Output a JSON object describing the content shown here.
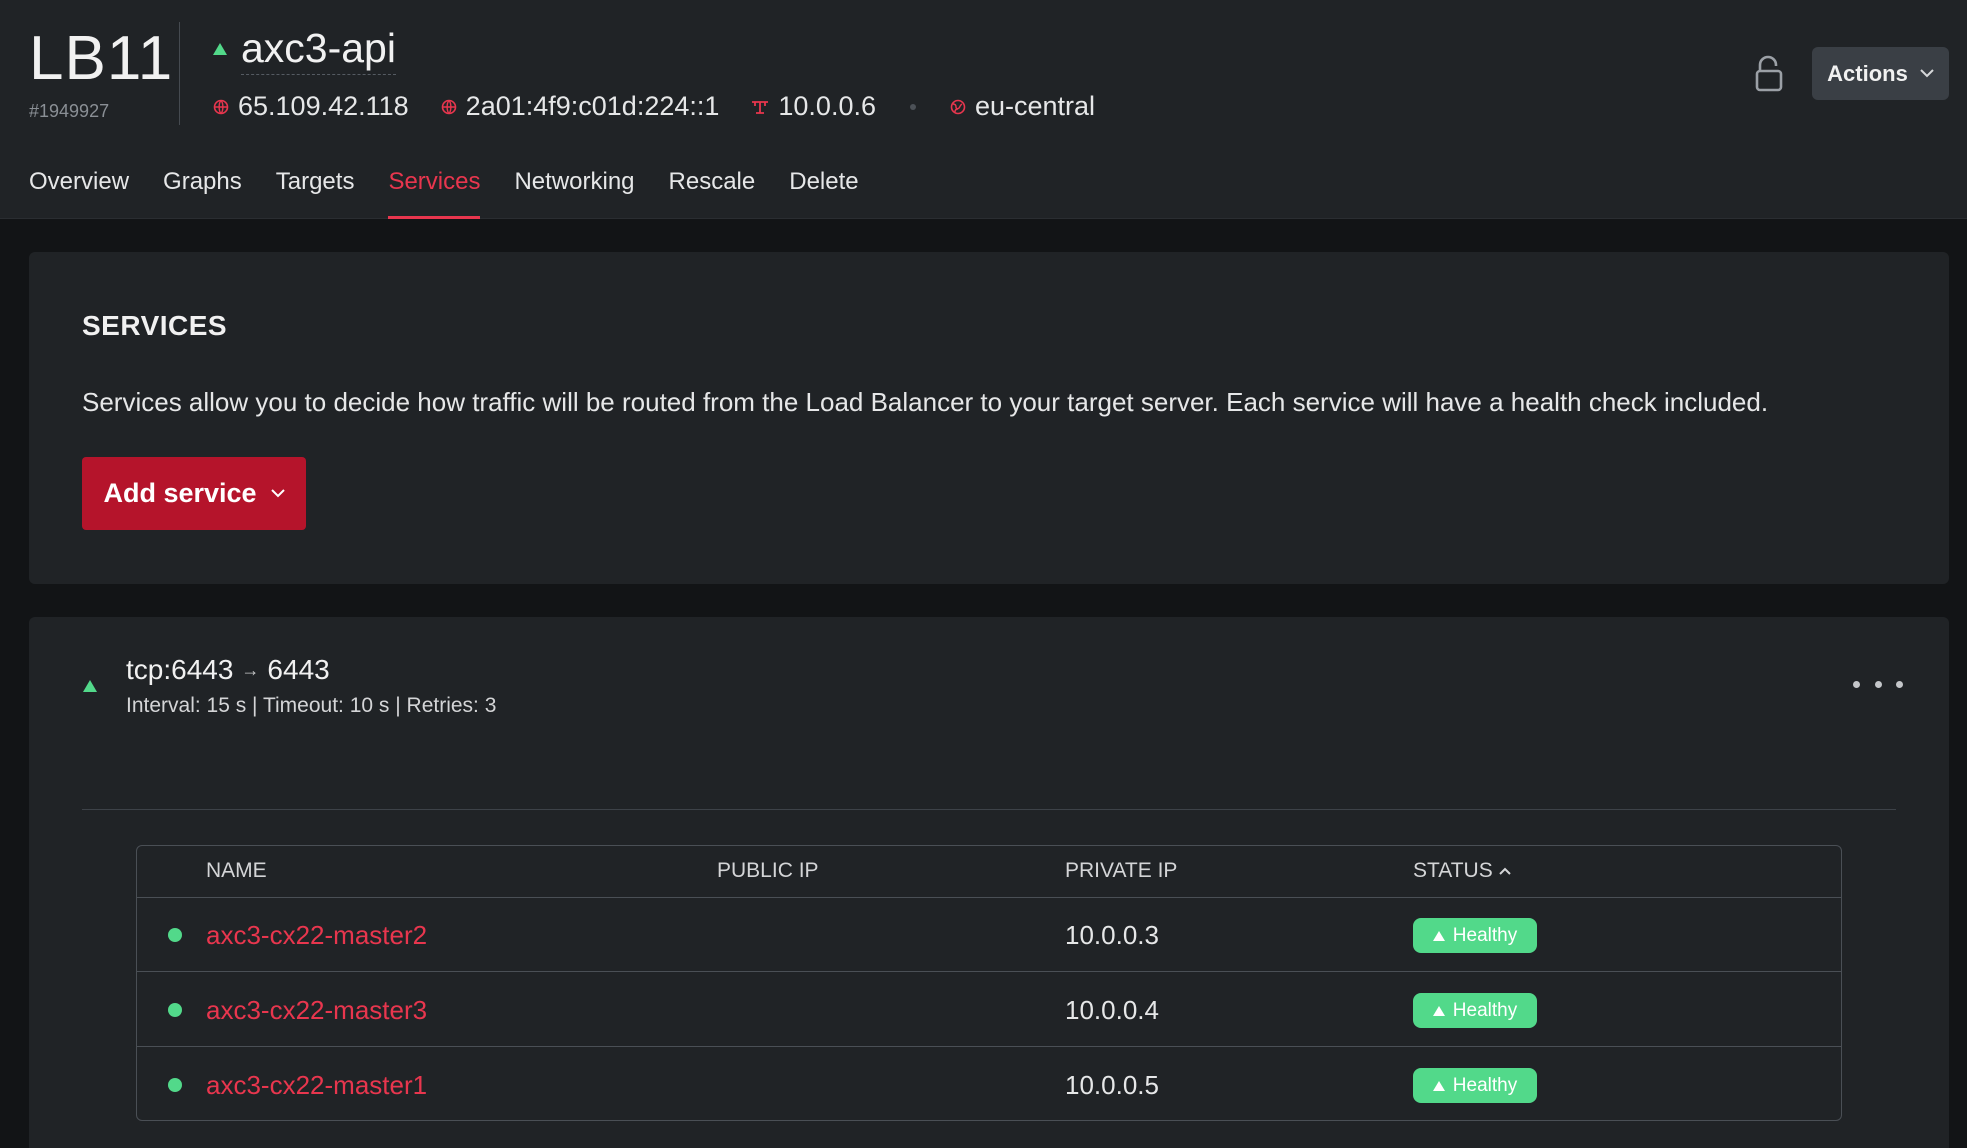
{
  "header": {
    "type": "LB11",
    "id": "#1949927",
    "name": "axc3-api",
    "ipv4": "65.109.42.118",
    "ipv6": "2a01:4f9:c01d:224::1",
    "private_ip": "10.0.0.6",
    "location": "eu-central",
    "actions_label": "Actions"
  },
  "tabs": [
    {
      "label": "Overview"
    },
    {
      "label": "Graphs"
    },
    {
      "label": "Targets"
    },
    {
      "label": "Services",
      "active": true
    },
    {
      "label": "Networking"
    },
    {
      "label": "Rescale"
    },
    {
      "label": "Delete"
    }
  ],
  "services_card": {
    "title": "SERVICES",
    "description": "Services allow you to decide how traffic will be routed from the Load Balancer to your target server. Each service will have a health check included.",
    "add_button": "Add service"
  },
  "service": {
    "listen": "tcp:6443",
    "arrow": "→",
    "destination": "6443",
    "meta": "Interval: 15 s | Timeout: 10 s | Retries: 3",
    "columns": {
      "name": "NAME",
      "public_ip": "PUBLIC IP",
      "private_ip": "PRIVATE IP",
      "status": "STATUS"
    },
    "targets": [
      {
        "name": "axc3-cx22-master2",
        "public_ip": "",
        "private_ip": "10.0.0.3",
        "status": "Healthy"
      },
      {
        "name": "axc3-cx22-master3",
        "public_ip": "",
        "private_ip": "10.0.0.4",
        "status": "Healthy"
      },
      {
        "name": "axc3-cx22-master1",
        "public_ip": "",
        "private_ip": "10.0.0.5",
        "status": "Healthy"
      }
    ]
  },
  "colors": {
    "accent": "#e8364e",
    "primary_button": "#b5142b",
    "healthy": "#52d98a",
    "background": "#121416",
    "surface": "#202326"
  }
}
